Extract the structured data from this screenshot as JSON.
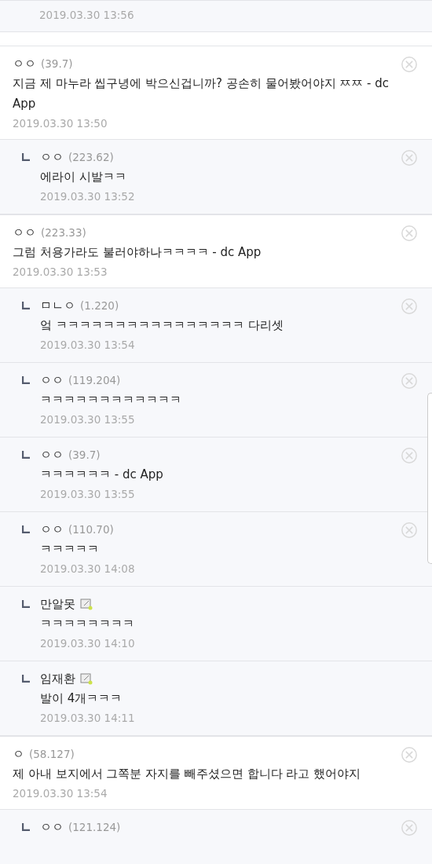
{
  "threads": [
    {
      "replies": [
        {
          "date": "2019.03.30 13:56"
        }
      ]
    },
    {
      "comment": {
        "nick": "ㅇㅇ",
        "ip": "(39.7)",
        "text": "지금 제 마누라 씹구녕에 박으신겁니까? 공손히 물어봤어야지 ㅉㅉ - dc App",
        "date": "2019.03.30 13:50",
        "deletable": true
      },
      "replies": [
        {
          "nick": "ㅇㅇ",
          "ip": "(223.62)",
          "text": "에라이 시발ㅋㅋ",
          "date": "2019.03.30 13:52",
          "deletable": true
        }
      ]
    },
    {
      "comment": {
        "nick": "ㅇㅇ",
        "ip": "(223.33)",
        "text": "그럼 처용가라도 불러야하나ㅋㅋㅋㅋ - dc App",
        "date": "2019.03.30 13:53",
        "deletable": true
      },
      "replies": [
        {
          "nick": "ㅁㄴㅇ",
          "ip": "(1.220)",
          "text": "엌 ㅋㅋㅋㅋㅋㅋㅋㅋㅋㅋㅋㅋㅋㅋㅋㅋ 다리셋",
          "date": "2019.03.30 13:54",
          "deletable": true
        },
        {
          "nick": "ㅇㅇ",
          "ip": "(119.204)",
          "text": "ㅋㅋㅋㅋㅋㅋㅋㅋㅋㅋㅋㅋ",
          "date": "2019.03.30 13:55",
          "deletable": true
        },
        {
          "nick": "ㅇㅇ",
          "ip": "(39.7)",
          "text": "ㅋㅋㅋㅋㅋㅋ - dc App",
          "date": "2019.03.30 13:55",
          "deletable": true
        },
        {
          "nick": "ㅇㅇ",
          "ip": "(110.70)",
          "text": "ㅋㅋㅋㅋㅋ",
          "date": "2019.03.30 14:08",
          "deletable": true
        },
        {
          "nick": "만알못",
          "member": true,
          "text": "ㅋㅋㅋㅋㅋㅋㅋㅋ",
          "date": "2019.03.30 14:10",
          "deletable": false
        },
        {
          "nick": "임재환",
          "member": true,
          "text": "발이 4개ㅋㅋㅋ",
          "date": "2019.03.30 14:11",
          "deletable": false
        }
      ]
    },
    {
      "comment": {
        "nick": "ㅇ",
        "ip": "(58.127)",
        "text": "제 아내 보지에서 그쪽분 자지를 빼주셨으면 합니다 라고 했어야지",
        "date": "2019.03.30 13:54",
        "deletable": true
      },
      "replies": [
        {
          "nick": "ㅇㅇ",
          "ip": "(121.124)",
          "deletable": true
        }
      ]
    }
  ]
}
